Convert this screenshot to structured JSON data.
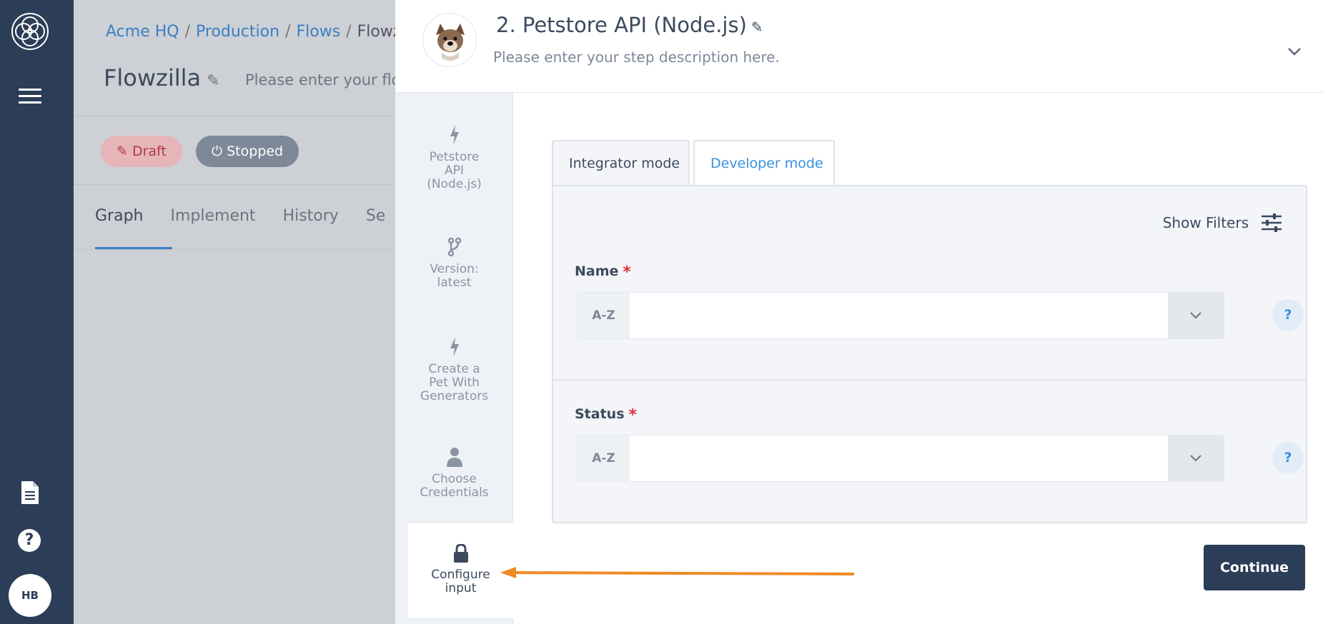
{
  "rail": {
    "avatar_initials": "HB",
    "help_glyph": "?"
  },
  "breadcrumb": {
    "org": "Acme HQ",
    "workspace": "Production",
    "section": "Flows",
    "current": "Flowzi",
    "sep": "/"
  },
  "flow": {
    "title": "Flowzilla",
    "description_placeholder": "Please enter your flow",
    "status_draft": "Draft",
    "status_stopped": "Stopped",
    "tabs": [
      "Graph",
      "Implement",
      "History",
      "Se"
    ]
  },
  "step": {
    "title": "2. Petstore API (Node.js)",
    "description": "Please enter your step description here."
  },
  "sidebar": {
    "items": [
      {
        "label1": "Petstore",
        "label2": "API",
        "label3": "(Node.js)",
        "icon": "lightning-icon"
      },
      {
        "label1": "Version:",
        "label2": "latest",
        "icon": "branch-icon"
      },
      {
        "label1": "Create a",
        "label2": "Pet With",
        "label3": "Generators",
        "icon": "lightning-icon"
      },
      {
        "label1": "Choose",
        "label2": "Credentials",
        "icon": "user-icon"
      },
      {
        "label1": "Configure",
        "label2": "input",
        "icon": "lock-icon"
      }
    ]
  },
  "mode_tabs": {
    "integrator": "Integrator mode",
    "developer": "Developer mode"
  },
  "form": {
    "show_filters": "Show Filters",
    "fields": [
      {
        "label": "Name",
        "required": "*",
        "type_badge": "A-Z",
        "value": "",
        "help": "?"
      },
      {
        "label": "Status",
        "required": "*",
        "type_badge": "A-Z",
        "value": "",
        "help": "?"
      }
    ]
  },
  "continue_label": "Continue",
  "colors": {
    "rail": "#2c3e57",
    "accent": "#3b90dc",
    "arrow": "#f08a24",
    "draft": "#b13a45"
  }
}
